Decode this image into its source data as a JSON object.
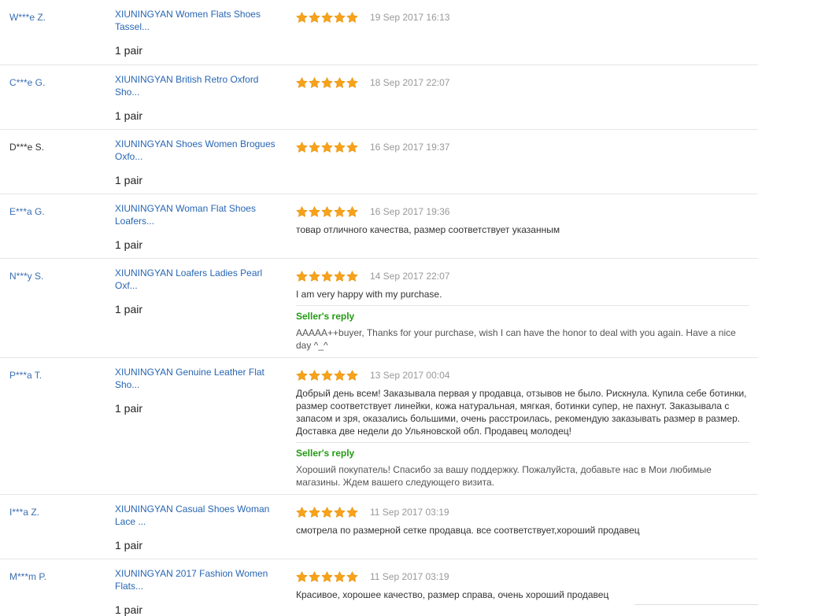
{
  "colors": {
    "buyer_link": "#3b6eb1",
    "product_link": "#2766b3",
    "star": "#f7a21a",
    "reply_title": "#239a12",
    "date": "#999999"
  },
  "rows": [
    {
      "buyer": "W***e Z.",
      "product": "XIUNINGYAN Women Flats Shoes Tassel...",
      "qty": "1 pair",
      "stars": 5,
      "date": "19 Sep 2017 16:13",
      "feedback": "",
      "reply_title": "",
      "reply_text": ""
    },
    {
      "buyer": "C***e G.",
      "product": "XIUNINGYAN British Retro Oxford Sho...",
      "qty": "1 pair",
      "stars": 5,
      "date": "18 Sep 2017 22:07",
      "feedback": "",
      "reply_title": "",
      "reply_text": ""
    },
    {
      "buyer": "D***e S.",
      "product": "XIUNINGYAN Shoes Women Brogues Oxfo...",
      "qty": "1 pair",
      "stars": 5,
      "date": "16 Sep 2017 19:37",
      "feedback": "",
      "reply_title": "",
      "reply_text": ""
    },
    {
      "buyer": "E***a G.",
      "product": "XIUNINGYAN Woman Flat Shoes Loafers...",
      "qty": "1 pair",
      "stars": 5,
      "date": "16 Sep 2017 19:36",
      "feedback": "товар отличного качества, размер соответствует указанным",
      "reply_title": "",
      "reply_text": ""
    },
    {
      "buyer": "N***y S.",
      "product": "XIUNINGYAN Loafers Ladies Pearl Oxf...",
      "qty": "1 pair",
      "stars": 5,
      "date": "14 Sep 2017 22:07",
      "feedback": "I am very happy with my purchase.",
      "reply_title": "Seller's reply",
      "reply_text": "AAAAA++buyer, Thanks for your purchase, wish I can have the honor to deal with you again. Have a nice day ^_^"
    },
    {
      "buyer": "P***a T.",
      "product": "XIUNINGYAN Genuine Leather Flat Sho...",
      "qty": "1 pair",
      "stars": 5,
      "date": "13 Sep 2017 00:04",
      "feedback": "Добрый день всем! Заказывала первая у продавца, отзывов не было. Рискнула. Купила себе ботинки, размер соответствует линейки, кожа натуральная, мягкая, ботинки супер, не пахнут. Заказывала с запасом и зря, оказались большими, очень расстроилась, рекомендую заказывать размер в размер. Доставка две недели до Ульяновской обл. Продавец молодец!",
      "reply_title": "Seller's reply",
      "reply_text": "Хороший покупатель! Спасибо за вашу поддержку. Пожалуйста, добавьте нас в Мои любимые магазины. Ждем вашего следующего визита."
    },
    {
      "buyer": "I***a Z.",
      "product": "XIUNINGYAN Casual Shoes Woman Lace ...",
      "qty": "1 pair",
      "stars": 5,
      "date": "11 Sep 2017 03:19",
      "feedback": "смотрела по размерной сетке продавца. все соответствует,хороший продавец",
      "reply_title": "",
      "reply_text": ""
    },
    {
      "buyer": "M***m P.",
      "product": "XIUNINGYAN 2017 Fashion Women Flats...",
      "qty": "1 pair",
      "stars": 5,
      "date": "11 Sep 2017 03:19",
      "feedback": "Красивое, хорошее качество, размер справа, очень хороший продавец",
      "reply_title": "",
      "reply_text": ""
    }
  ]
}
